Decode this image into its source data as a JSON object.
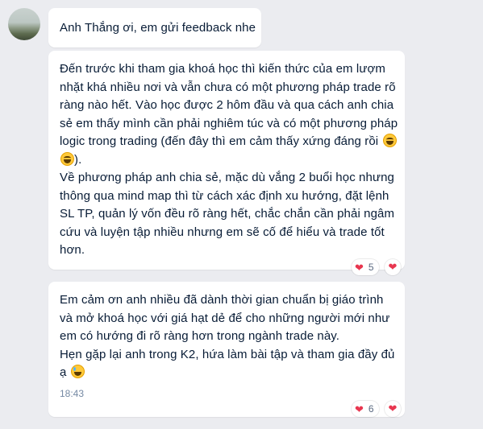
{
  "messages": [
    {
      "text": "Anh Thắng ơi, em gửi feedback nhe"
    },
    {
      "text_line1": "Đến trước khi tham gia khoá học thì kiến thức của em lượm nhặt khá nhiều nơi và vẫn chưa có một phương pháp trade rõ ràng nào hết. Vào học được 2 hôm đầu và qua cách anh chia sẻ em thấy mình cần phải nghiêm túc và có một phương pháp logic trong trading (đến đây thì em cảm thấy xứng đáng rồi ",
      "text_line1_end": ").",
      "text_para2": "Về phương pháp anh chia sẻ, mặc dù vắng 2 buổi học nhưng thông qua mind map thì từ cách xác định xu hướng, đặt lệnh SL TP, quản lý vốn đều rõ ràng hết, chắc chắn cần phải ngâm cứu và luyện tập nhiều nhưng em sẽ cố để hiểu và trade tốt hơn.",
      "emojis": [
        "laughing-emoji",
        "grinning-squint-emoji"
      ],
      "reaction_count": "5"
    },
    {
      "text": "Em cảm ơn anh nhiều đã dành thời gian chuẩn bị giáo trình và mở khoá học với giá hạt dẻ để cho những người mới như em có hướng đi rõ ràng hơn trong ngành trade này.\nHẹn gặp lại anh trong K2, hứa làm bài tập và tham gia đầy đủ ạ ",
      "emoji": "grinning-sweat-emoji",
      "time": "18:43",
      "reaction_count": "6"
    }
  ],
  "reaction_icon": "heart-icon",
  "colors": {
    "background": "#ebecf0",
    "bubble": "#ffffff",
    "text": "#081c36",
    "time": "#7589a3",
    "heart": "#e8364f"
  }
}
